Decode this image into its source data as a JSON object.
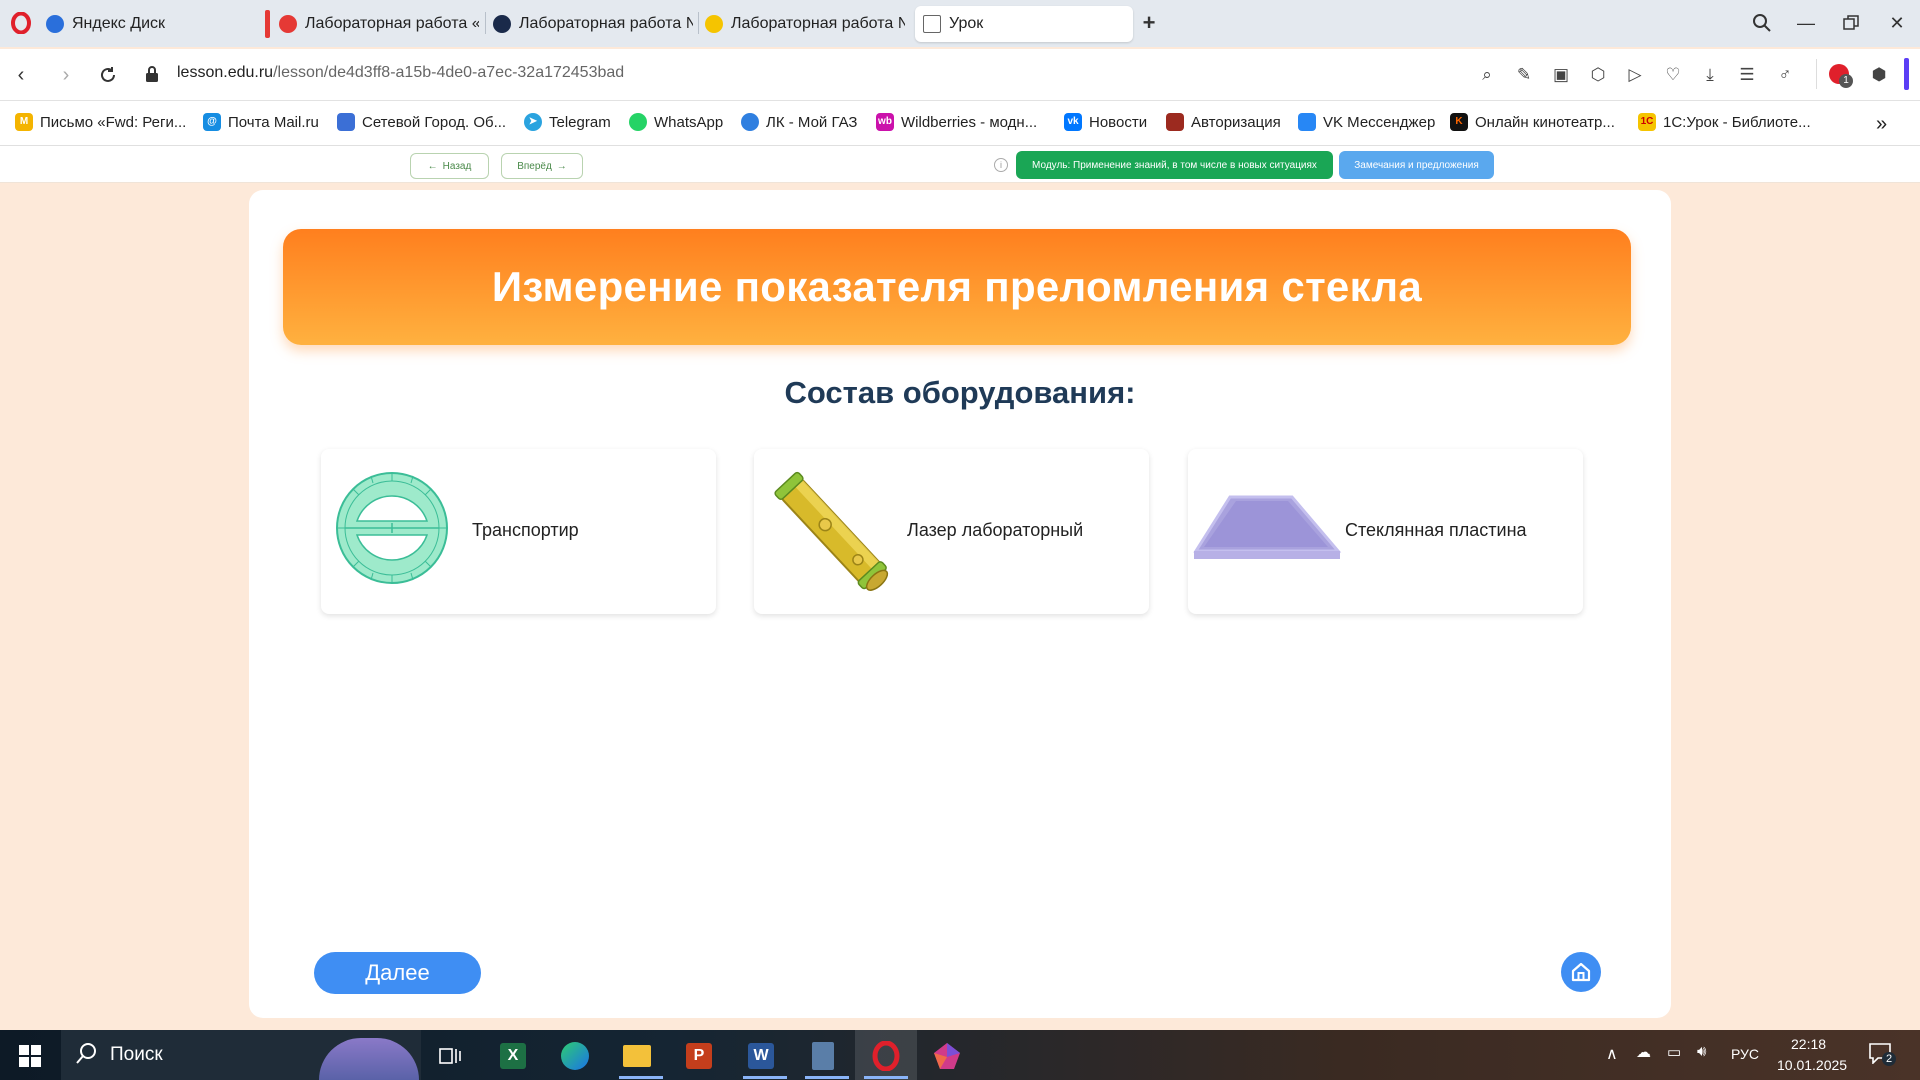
{
  "browser": {
    "tabs": [
      {
        "label": "Яндекс Диск",
        "icon": "yandex-disk-icon",
        "color": "#2a6fdb"
      },
      {
        "label": "Лабораторная работа «И",
        "icon": "yandex-icon",
        "color": "#e53935"
      },
      {
        "label": "Лабораторная работа №",
        "icon": "app-icon",
        "color": "#1a2a4a"
      },
      {
        "label": "Лабораторная работа №",
        "icon": "play-icon",
        "color": "#f5c400"
      },
      {
        "label": "Урок",
        "icon": "page-icon",
        "color": "#666666"
      }
    ],
    "url_host": "lesson.edu.ru",
    "url_path": "/lesson/de4d3ff8-a15b-4de0-a7ec-32a172453bad",
    "extension_badge": "1",
    "bookmarks": [
      {
        "label": "Письмо «Fwd: Реги...",
        "icon": "mail-icon",
        "color": "#f4b400"
      },
      {
        "label": "Почта Mail.ru",
        "icon": "mailru-icon",
        "color": "#168de2"
      },
      {
        "label": "Сетевой Город. Об...",
        "icon": "grid-icon",
        "color": "#3b6fd6"
      },
      {
        "label": "Telegram",
        "icon": "telegram-icon",
        "color": "#2aa3df"
      },
      {
        "label": "WhatsApp",
        "icon": "whatsapp-icon",
        "color": "#25d366"
      },
      {
        "label": "ЛК - Мой ГАЗ",
        "icon": "gas-icon",
        "color": "#2f7fe0"
      },
      {
        "label": "Wildberries - модн...",
        "icon": "wildberries-icon",
        "color": "#cb11ab"
      },
      {
        "label": "Новости",
        "icon": "vk-icon",
        "color": "#0077ff"
      },
      {
        "label": "Авторизация",
        "icon": "auth-icon",
        "color": "#9c2a1f"
      },
      {
        "label": "VK Мессенджер",
        "icon": "vk-messenger-icon",
        "color": "#2787f5"
      },
      {
        "label": "Онлайн кинотеатр...",
        "icon": "kinopoisk-icon",
        "color": "#111111"
      },
      {
        "label": "1С:Урок - Библиоте...",
        "icon": "1c-icon",
        "color": "#f5c400"
      }
    ]
  },
  "site_header": {
    "back_label": "Назад",
    "forward_label": "Вперёд",
    "module_label": "Модуль: Применение знаний, в том числе в новых ситуациях",
    "feedback_label": "Замечания и предложения"
  },
  "lesson": {
    "title": "Измерение показателя преломления стекла",
    "subtitle": "Состав оборудования:",
    "equipment": [
      {
        "label": "Транспортир",
        "icon": "protractor-icon"
      },
      {
        "label": "Лазер лабораторный",
        "icon": "laser-icon"
      },
      {
        "label": "Стеклянная пластина",
        "icon": "glass-plate-icon"
      }
    ],
    "next_label": "Далее"
  },
  "taskbar": {
    "search_placeholder": "Поиск",
    "lang": "РУС",
    "time": "22:18",
    "date": "10.01.2025",
    "notifications": "2"
  },
  "colors": {
    "accent_blue": "#3f8ef3",
    "banner_orange": "#ff8a24",
    "module_green": "#1aa655",
    "feedback_blue": "#5aa8ee",
    "page_bg": "#fde9d9"
  }
}
